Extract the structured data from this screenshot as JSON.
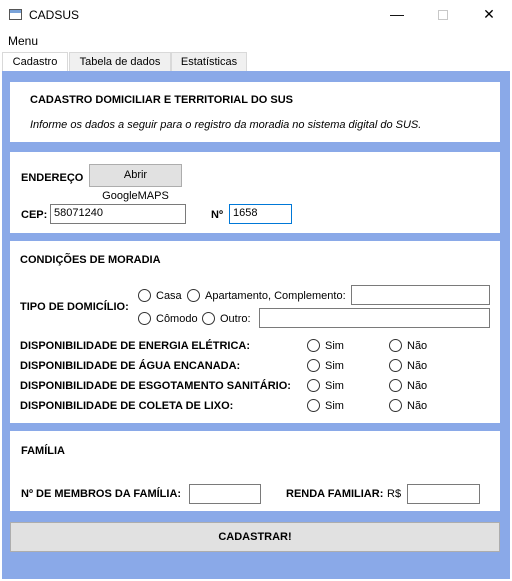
{
  "window": {
    "title": "CADSUS",
    "min_glyph": "—",
    "close_glyph": "✕"
  },
  "menu": {
    "label": "Menu"
  },
  "tabs": [
    {
      "label": "Cadastro"
    },
    {
      "label": "Tabela de dados"
    },
    {
      "label": "Estatísticas"
    }
  ],
  "header": {
    "title": "CADASTRO DOMICILIAR E TERRITORIAL DO SUS",
    "subtitle": "Informe os dados a seguir para o registro da moradia no sistema digital do SUS."
  },
  "address": {
    "endereco_label": "ENDEREÇO",
    "maps_button": "Abrir GoogleMAPS",
    "cep_label": "CEP:",
    "cep_value": "58071240",
    "numero_label": "Nº",
    "numero_value": "1658"
  },
  "housing": {
    "section_title": "CONDIÇÕES DE MORADIA",
    "tipo_label": "TIPO DE DOMICÍLIO:",
    "options": {
      "casa": "Casa",
      "apartamento": "Apartamento, Complemento:",
      "comodo": "Cômodo",
      "outro": "Outro:"
    },
    "complemento_value": "",
    "outro_value": "",
    "availability": [
      {
        "label": "DISPONIBILIDADE DE ENERGIA ELÉTRICA:",
        "yes": "Sim",
        "no": "Não"
      },
      {
        "label": "DISPONIBILIDADE DE ÁGUA ENCANADA:",
        "yes": "Sim",
        "no": "Não"
      },
      {
        "label": "DISPONIBILIDADE DE ESGOTAMENTO SANITÁRIO:",
        "yes": "Sim",
        "no": "Não"
      },
      {
        "label": "DISPONIBILIDADE DE COLETA DE LIXO:",
        "yes": "Sim",
        "no": "Não"
      }
    ]
  },
  "family": {
    "section_title": "FAMÍLIA",
    "members_label": "Nº DE MEMBROS DA FAMÍLIA:",
    "members_value": "",
    "income_label": "RENDA FAMILIAR:",
    "currency": "R$",
    "income_value": ""
  },
  "submit_label": "CADASTRAR!",
  "colors": {
    "content_bg": "#8aa9e8",
    "focus_border": "#0078d7"
  }
}
